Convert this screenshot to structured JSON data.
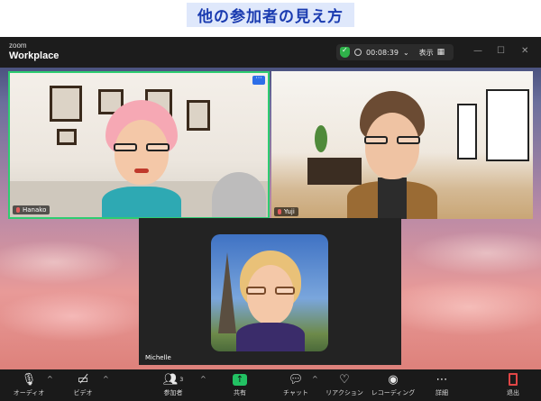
{
  "page": {
    "title": "他の参加者の見え方"
  },
  "window": {
    "brand_small": "zoom",
    "brand_big": "Workplace",
    "timer": "00:08:39",
    "view_label": "表示"
  },
  "participants": [
    {
      "name": "Hanako"
    },
    {
      "name": "Yuji"
    },
    {
      "name": "Michelle"
    }
  ],
  "toolbar": {
    "audio": "オーディオ",
    "video": "ビデオ",
    "participants": "参加者",
    "participants_count": "3",
    "share": "共有",
    "chat": "チャット",
    "reactions": "リアクション",
    "record": "レコーディング",
    "more": "詳細",
    "leave": "退出"
  },
  "colors": {
    "active_speaker_border": "#2ecc71",
    "share_green": "#22c163",
    "leave_red": "#e04646",
    "title_blue": "#1a3bb0"
  },
  "icons": [
    "shield-check-icon",
    "clock-icon",
    "chevron-down-icon",
    "grid-icon",
    "minimize-icon",
    "maximize-icon",
    "close-icon",
    "more-icon",
    "mic-muted-icon",
    "video-off-icon",
    "participants-icon",
    "share-screen-icon",
    "chat-icon",
    "heart-icon",
    "record-icon",
    "ellipsis-icon",
    "leave-icon"
  ]
}
